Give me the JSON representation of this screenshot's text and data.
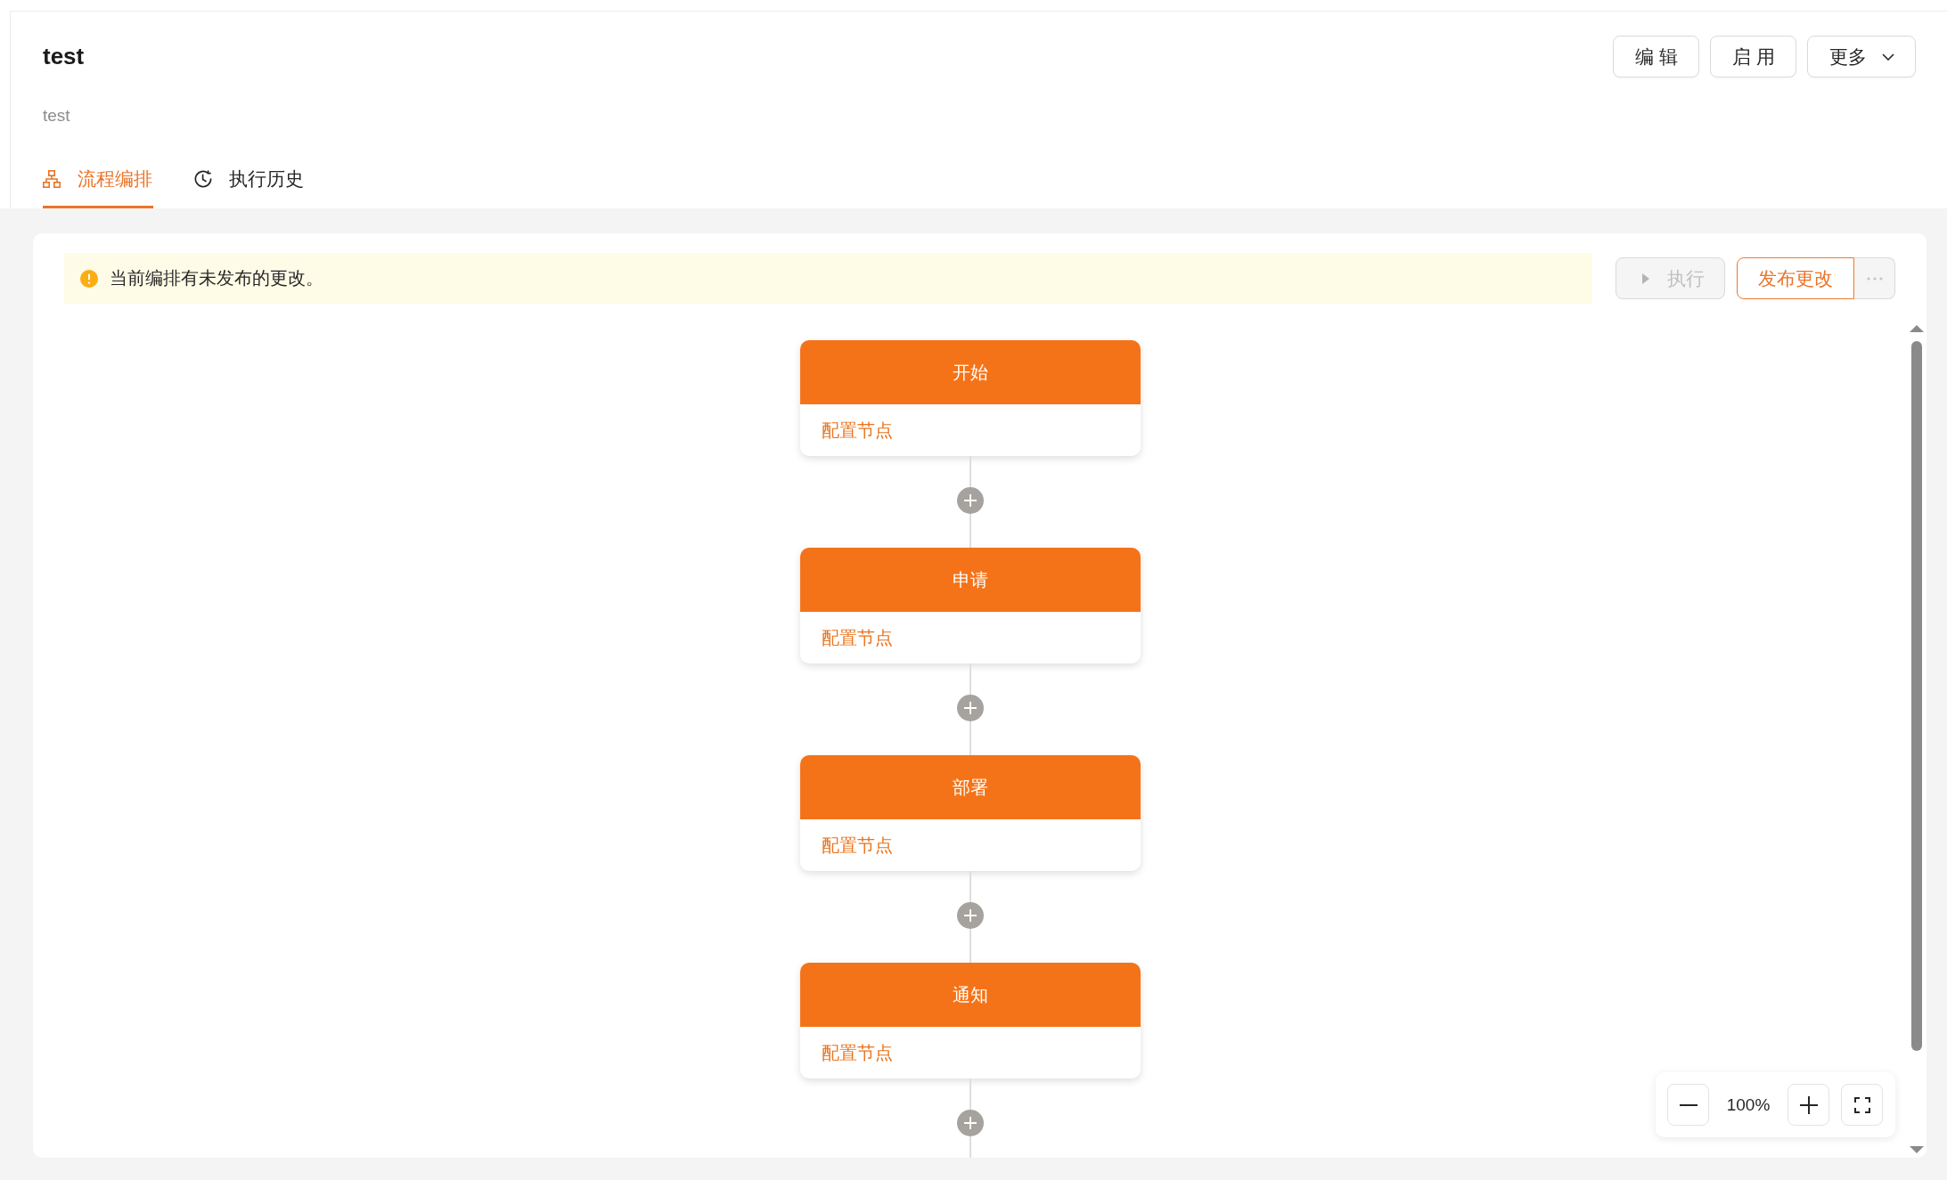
{
  "header": {
    "title": "test",
    "description": "test",
    "actions": [
      {
        "kind": "button",
        "label": "编 辑"
      },
      {
        "kind": "button",
        "label": "启 用"
      },
      {
        "kind": "dropdown",
        "label": "更多"
      }
    ]
  },
  "tabs": [
    {
      "label": "流程编排",
      "selected": true
    },
    {
      "label": "执行历史",
      "selected": false
    }
  ],
  "alert": {
    "message": "当前编排有未发布的更改。"
  },
  "toolbar": [
    {
      "kind": "run",
      "label": "执行",
      "disabled": true
    },
    {
      "kind": "publish",
      "label": "发布更改",
      "disabled": false
    },
    {
      "kind": "more",
      "disabled": true
    }
  ],
  "flow": {
    "nodes": [
      {
        "title": "开始",
        "action": "配置节点"
      },
      {
        "title": "申请",
        "action": "配置节点"
      },
      {
        "title": "部署",
        "action": "配置节点"
      },
      {
        "title": "通知",
        "action": "配置节点"
      }
    ]
  },
  "zoom_control": {
    "reading": "100%"
  }
}
